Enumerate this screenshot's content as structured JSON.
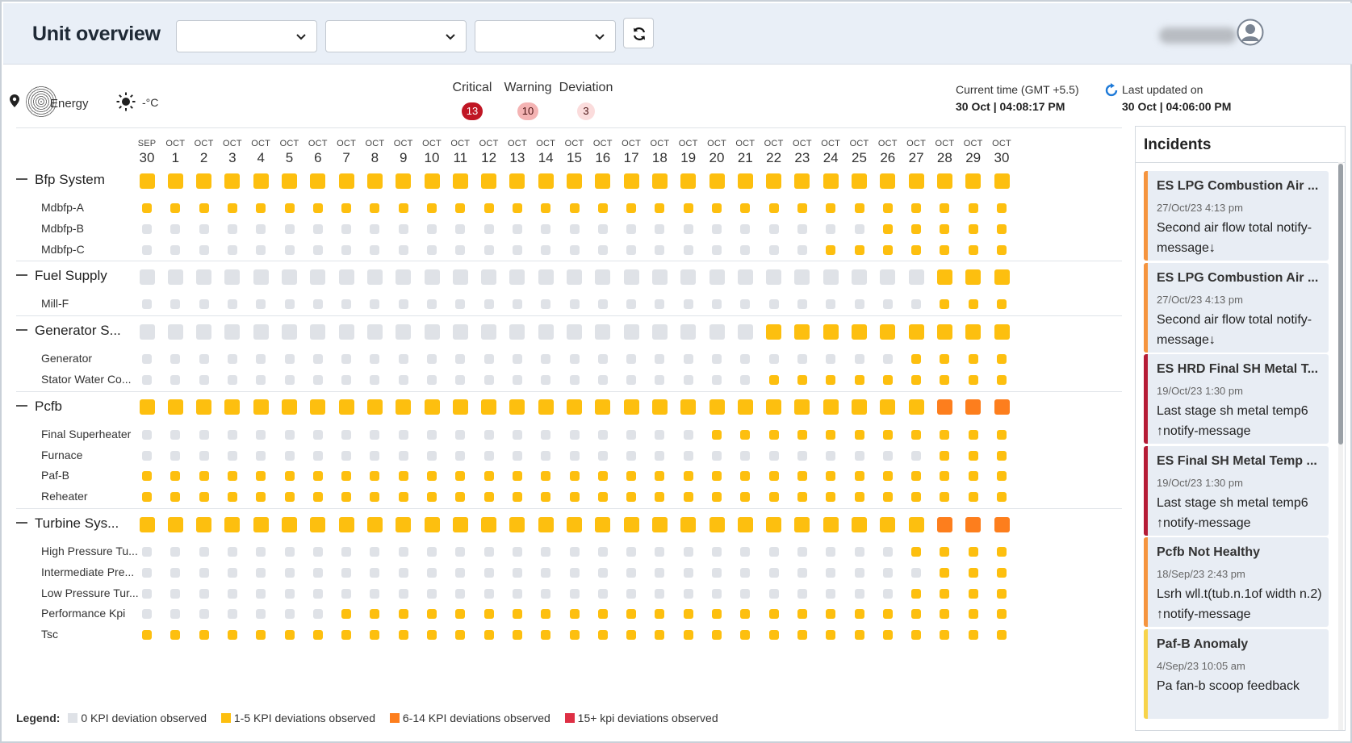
{
  "header": {
    "title": "Unit overview"
  },
  "info": {
    "location": "Energy",
    "temperature": "-°C",
    "severity": [
      {
        "label": "Critical",
        "count": "13",
        "kind": "crit"
      },
      {
        "label": "Warning",
        "count": "10",
        "kind": "warn"
      },
      {
        "label": "Deviation",
        "count": "3",
        "kind": "dev"
      }
    ],
    "current_time_label": "Current time (GMT +5.5)",
    "current_time_value": "30 Oct | 04:08:17 PM",
    "last_updated_label": "Last updated on",
    "last_updated_value": "30 Oct | 04:06:00 PM"
  },
  "colors": {
    "none": "#dfe2e7",
    "low": "#fdbf0f",
    "mid": "#fd7e1d",
    "high": "#de2f44"
  },
  "dates": [
    {
      "m": "SEP",
      "d": "30"
    },
    {
      "m": "OCT",
      "d": "1"
    },
    {
      "m": "OCT",
      "d": "2"
    },
    {
      "m": "OCT",
      "d": "3"
    },
    {
      "m": "OCT",
      "d": "4"
    },
    {
      "m": "OCT",
      "d": "5"
    },
    {
      "m": "OCT",
      "d": "6"
    },
    {
      "m": "OCT",
      "d": "7"
    },
    {
      "m": "OCT",
      "d": "8"
    },
    {
      "m": "OCT",
      "d": "9"
    },
    {
      "m": "OCT",
      "d": "10"
    },
    {
      "m": "OCT",
      "d": "11"
    },
    {
      "m": "OCT",
      "d": "12"
    },
    {
      "m": "OCT",
      "d": "13"
    },
    {
      "m": "OCT",
      "d": "14"
    },
    {
      "m": "OCT",
      "d": "15"
    },
    {
      "m": "OCT",
      "d": "16"
    },
    {
      "m": "OCT",
      "d": "17"
    },
    {
      "m": "OCT",
      "d": "18"
    },
    {
      "m": "OCT",
      "d": "19"
    },
    {
      "m": "OCT",
      "d": "20"
    },
    {
      "m": "OCT",
      "d": "21"
    },
    {
      "m": "OCT",
      "d": "22"
    },
    {
      "m": "OCT",
      "d": "23"
    },
    {
      "m": "OCT",
      "d": "24"
    },
    {
      "m": "OCT",
      "d": "25"
    },
    {
      "m": "OCT",
      "d": "26"
    },
    {
      "m": "OCT",
      "d": "27"
    },
    {
      "m": "OCT",
      "d": "28"
    },
    {
      "m": "OCT",
      "d": "29"
    },
    {
      "m": "OCT",
      "d": "30"
    }
  ],
  "groups": [
    {
      "name": "Bfp System",
      "status": "1111111111111111111111111111111",
      "children": [
        {
          "name": "Mdbfp-A",
          "status": "1111111111111111111111111111111"
        },
        {
          "name": "Mdbfp-B",
          "status": "0000000000000000000000000011111"
        },
        {
          "name": "Mdbfp-C",
          "status": "0000000000000000000000001111111"
        }
      ]
    },
    {
      "name": "Fuel Supply",
      "status": "0000000000000000000000000000111",
      "children": [
        {
          "name": "Mill-F",
          "status": "0000000000000000000000000000111"
        }
      ]
    },
    {
      "name": "Generator S...",
      "status": "0000000000000000000000111111111",
      "children": [
        {
          "name": "Generator",
          "status": "0000000000000000000000000001111"
        },
        {
          "name": "Stator Water Co...",
          "status": "0000000000000000000000111111111"
        }
      ]
    },
    {
      "name": "Pcfb",
      "status": "1111111111111111111111111111222",
      "children": [
        {
          "name": "Final Superheater",
          "status": "0000000000000000000011111111111"
        },
        {
          "name": "Furnace",
          "status": "0000000000000000000000000000111"
        },
        {
          "name": "Paf-B",
          "status": "1111111111111111111111111111111"
        },
        {
          "name": "Reheater",
          "status": "1111111111111111111111111111111"
        }
      ]
    },
    {
      "name": "Turbine Sys...",
      "status": "1111111111111111111111111111222",
      "children": [
        {
          "name": "High Pressure Tu...",
          "status": "0000000000000000000000000001111"
        },
        {
          "name": "Intermediate Pre...",
          "status": "0000000000000000000000000000111"
        },
        {
          "name": "Low Pressure Tur...",
          "status": "0000000000000000000000000001111"
        },
        {
          "name": "Performance Kpi",
          "status": "0000000111111111111111111111111"
        },
        {
          "name": "Tsc",
          "status": "1111111111111111111111111111111"
        }
      ]
    }
  ],
  "legend": {
    "title": "Legend:",
    "items": [
      {
        "label": "0 KPI deviation observed",
        "key": "none"
      },
      {
        "label": "1-5 KPI deviations observed",
        "key": "low"
      },
      {
        "label": "6-14 KPI deviations observed",
        "key": "mid"
      },
      {
        "label": "15+ kpi deviations observed",
        "key": "high"
      }
    ]
  },
  "incidents": {
    "title": "Incidents",
    "items": [
      {
        "title": "ES LPG Combustion Air ...",
        "date": "27/Oct/23 4:13 pm",
        "message": "Second air flow total notify-message",
        "arrow": "↓",
        "prefix": false,
        "color": "#f5943e"
      },
      {
        "title": "ES LPG Combustion Air ...",
        "date": "27/Oct/23 4:13 pm",
        "message": "Second air flow total notify-message",
        "arrow": "↓",
        "prefix": false,
        "color": "#f5943e"
      },
      {
        "title": "ES HRD Final SH Metal T...",
        "date": "19/Oct/23 1:30 pm",
        "message": "Last stage sh metal temp6 ",
        "message2": "notify-message",
        "arrow": "↑",
        "prefix": true,
        "color": "#b51c36"
      },
      {
        "title": "ES Final SH Metal Temp ...",
        "date": "19/Oct/23 1:30 pm",
        "message": "Last stage sh metal temp6 ",
        "message2": "notify-message",
        "arrow": "↑",
        "prefix": true,
        "color": "#b51c36"
      },
      {
        "title": "Pcfb Not Healthy",
        "date": "18/Sep/23 2:43 pm",
        "message": "Lsrh wll.t(tub.n.1of width n.2) ",
        "message2": "notify-message",
        "arrow": "↑",
        "prefix": true,
        "color": "#f5943e"
      },
      {
        "title": "Paf-B Anomaly",
        "date": "4/Sep/23 10:05 am",
        "message": "Pa fan-b scoop feedback",
        "arrow": "",
        "prefix": false,
        "color": "#f7d34a"
      }
    ]
  }
}
